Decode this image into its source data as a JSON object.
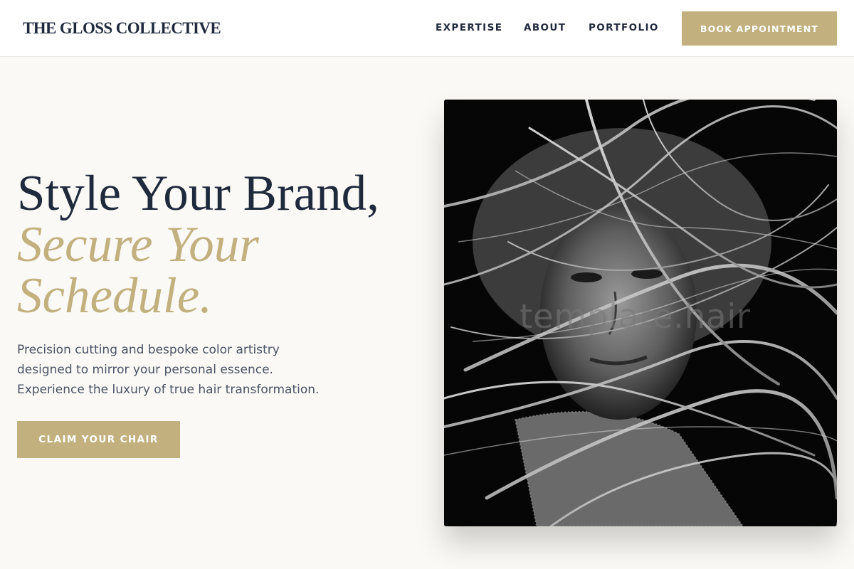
{
  "brand": {
    "name": "THE GLOSS COLLECTIVE"
  },
  "nav": {
    "items": [
      {
        "label": "EXPERTISE"
      },
      {
        "label": "ABOUT"
      },
      {
        "label": "PORTFOLIO"
      }
    ],
    "book_label": "BOOK APPOINTMENT"
  },
  "hero": {
    "title_line1": "Style Your Brand,",
    "title_line2": "Secure Your",
    "title_line3": "Schedule.",
    "subtitle_lines": [
      "Precision cutting and bespoke color artistry",
      "designed to mirror your personal essence.",
      "Experience the luxury of true hair transformation."
    ],
    "cta_label": "CLAIM YOUR CHAIR"
  },
  "photo": {
    "subject": "black-and-white portrait of woman with windswept blonde hair",
    "watermark": "template.hair"
  },
  "colors": {
    "accent": "#c2b07e",
    "navy": "#1f2a3d",
    "background": "#fbf9f5",
    "body_text": "#4a5365"
  }
}
